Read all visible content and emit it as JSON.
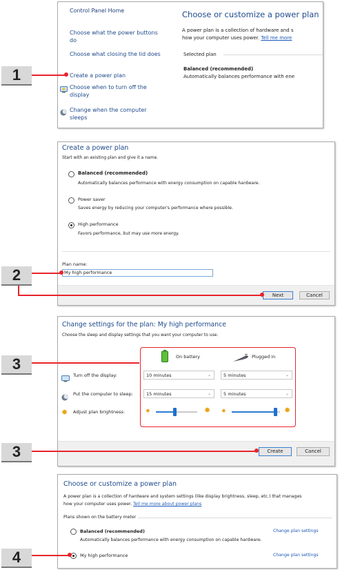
{
  "steps": [
    "1",
    "2",
    "3",
    "3",
    "4"
  ],
  "panel1": {
    "sidebar": {
      "home": "Control Panel Home",
      "items": [
        "Choose what the power buttons do",
        "Choose what closing the lid does",
        "Create a power plan",
        "Choose when to turn off the display",
        "Change when the computer sleeps"
      ]
    },
    "title": "Choose or customize a power plan",
    "desc1": "A power plan is a collection of hardware and s",
    "desc2": "how your computer uses power.",
    "tell_me": "Tell me more",
    "selected_plan": "Selected plan",
    "plan_name": "Balanced (recommended)",
    "plan_desc": "Automatically balances performance with ene"
  },
  "panel2": {
    "title": "Create a power plan",
    "subtitle": "Start with an existing plan and give it a name.",
    "options": [
      {
        "name": "Balanced (recommended)",
        "desc": "Automatically balances performance with energy consumption on capable hardware.",
        "selected": false,
        "bold": true
      },
      {
        "name": "Power saver",
        "desc": "Saves energy by reducing your computer's performance where possible.",
        "selected": false,
        "bold": false
      },
      {
        "name": "High performance",
        "desc": "Favors performance, but may use more energy.",
        "selected": true,
        "bold": false
      }
    ],
    "plan_name_label": "Plan name:",
    "plan_name_value": "My high performance",
    "next": "Next",
    "cancel": "Cancel"
  },
  "panel3": {
    "title": "Change settings for the plan: My high performance",
    "subtitle": "Choose the sleep and display settings that you want your computer to use.",
    "on_battery": "On battery",
    "plugged_in": "Plugged in",
    "rows": [
      {
        "label": "Turn off the display:",
        "battery": "10 minutes",
        "plugged": "5 minutes"
      },
      {
        "label": "Put the computer to sleep:",
        "battery": "15 minutes",
        "plugged": "5 minutes"
      }
    ],
    "brightness_label": "Adjust plan brightness:",
    "brightness_battery": 0.45,
    "brightness_plugged": 0.9,
    "create": "Create",
    "cancel": "Cancel"
  },
  "panel4": {
    "title": "Choose or customize a power plan",
    "desc1": "A power plan is a collection of hardware and system settings (like display brightness, sleep, etc.) that manages",
    "desc2": "how your computer uses power.",
    "tell_me": "Tell me more about power plans",
    "section": "Plans shown on the battery meter",
    "plans": [
      {
        "name": "Balanced (recommended)",
        "desc": "Automatically balances performance with energy consumption on capable hardware.",
        "selected": false,
        "change": "Change plan settings"
      },
      {
        "name": "My high performance",
        "desc": "",
        "selected": true,
        "change": "Change plan settings"
      }
    ]
  },
  "colors": {
    "accent_red": "#e8232a",
    "link_blue": "#1a57b8",
    "title_blue": "#1e4a8c"
  }
}
